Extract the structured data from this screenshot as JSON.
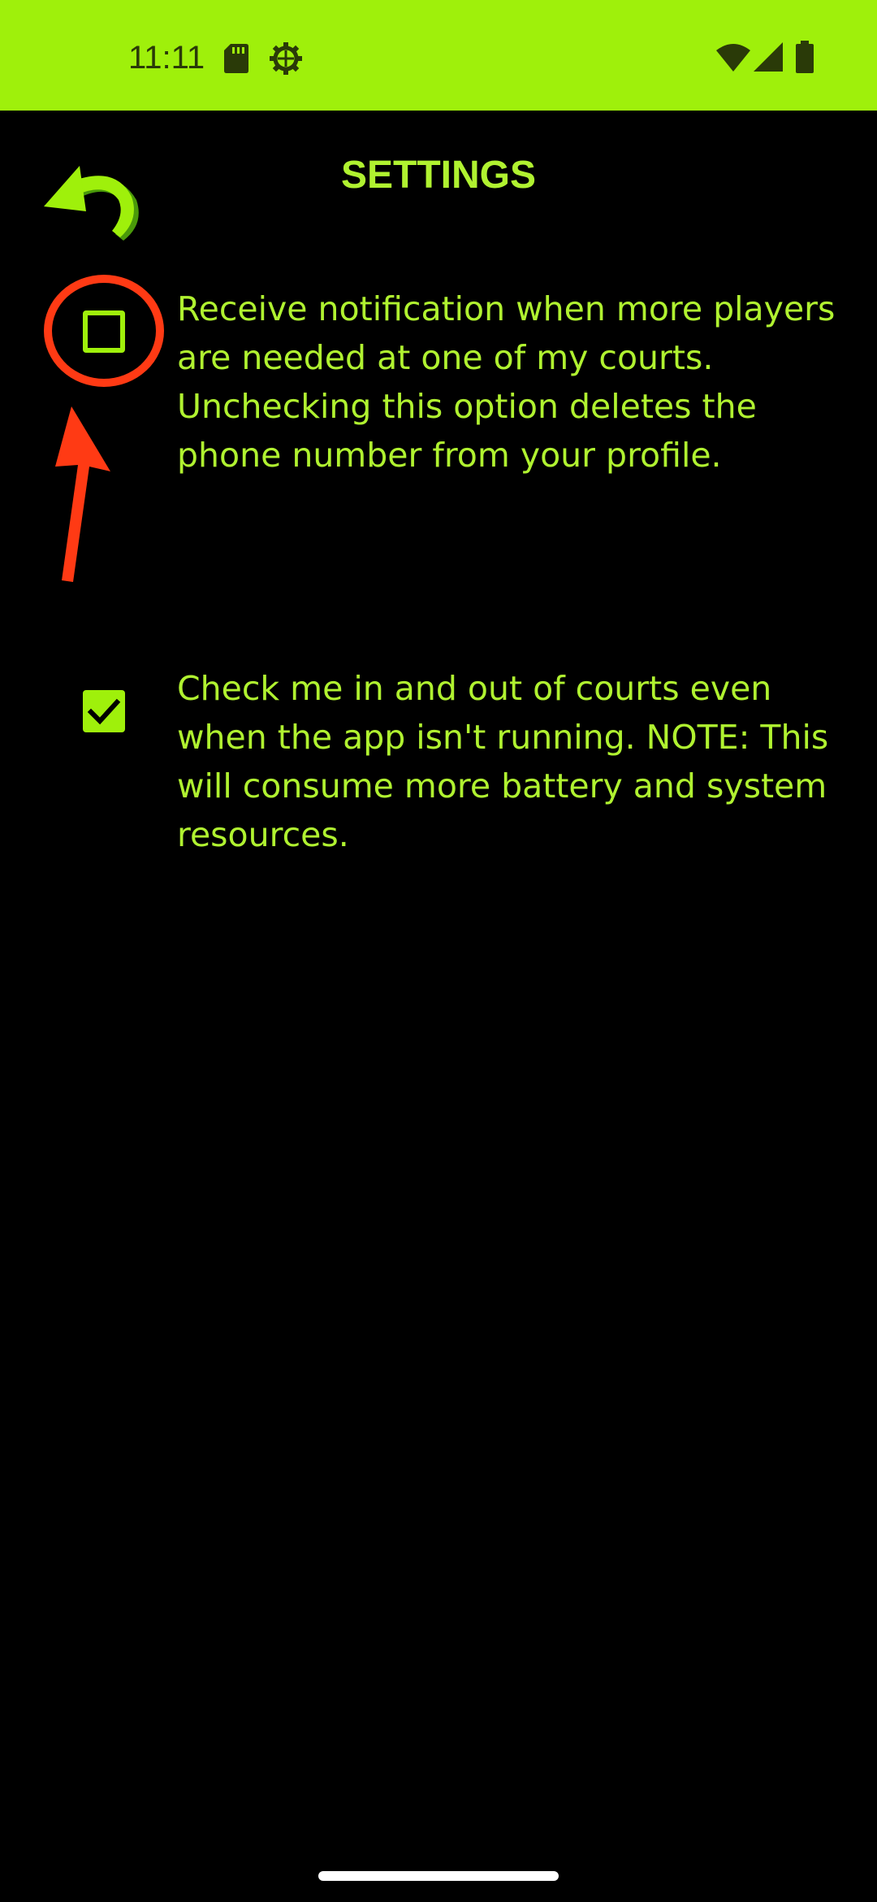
{
  "status_bar": {
    "time": "11:11",
    "icons_left": [
      "sd-card-icon",
      "settings-gear-icon"
    ],
    "icons_right": [
      "wifi-icon",
      "cell-signal-icon",
      "battery-icon"
    ]
  },
  "header": {
    "title": "SETTINGS",
    "back_icon": "curved-back-arrow-icon"
  },
  "settings": [
    {
      "checked": false,
      "label": "Receive notification when more players are needed at one of my courts. Unchecking this option deletes the phone number from your profile."
    },
    {
      "checked": true,
      "label": "Check me in and out of courts even when the app isn't running. NOTE: This will consume more battery and system resources."
    }
  ],
  "annotation": {
    "color": "#ff3a14"
  },
  "colors": {
    "status_bar_bg": "#9ff00b",
    "accent": "#b0f230",
    "background": "#000000"
  }
}
